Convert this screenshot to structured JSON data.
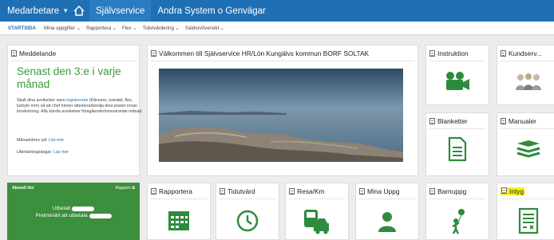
{
  "topbar": {
    "employee": "Medarbetare",
    "self_service": "Självservice",
    "other_systems": "Andra System o Genvägar"
  },
  "subnav": {
    "items": [
      "STARTSIDA",
      "Mina uppgifter",
      "Rapportera",
      "Flex",
      "Tidutvärdering",
      "Saldon/översikt"
    ]
  },
  "message": {
    "header": "Meddelande",
    "title": "Senast den 3:e i varje månad",
    "p1_pre": "Skall dina avvikelser vara ",
    "p1_link": "registrerade",
    "p1_post": " (frånvaro, extratid, flex, turbyte mm) så att chef hinner attestera/bevilja dina poster innan lönekörning. Alla kända avvikelser föregående/innevarande månad.",
    "p2_pre": "Månadsbrev juli: ",
    "p2_link": "Läs mer",
    "p3_pre": "Utbetalningsdagar: ",
    "p3_link": "Läs mer"
  },
  "welcome": {
    "header": "Välkommen till Självservice HR/Lön Kungälvs kommun BORF SOLTAK"
  },
  "tiles": {
    "instruktion": "Instruktion",
    "kundserv": "Kundserv...",
    "blanketter": "Blanketter",
    "manualer": "Manualer",
    "rapportera": "Rapportera",
    "tidutvard": "Tidutvärd",
    "resakm": "Resa/Km",
    "minauppg": "Mina Uppg",
    "barnuppg": "Barnuppg",
    "intyg": "Intyg"
  },
  "salary": {
    "title": "Aktuell lön",
    "link": "Rapport",
    "line1": "Utbetalt",
    "line2": "Preliminärt att utbetala"
  },
  "colors": {
    "brand": "#1f6fb5",
    "accent": "#3c8f3c",
    "icon": "#2e8b3e",
    "highlight": "#f6f31e"
  }
}
